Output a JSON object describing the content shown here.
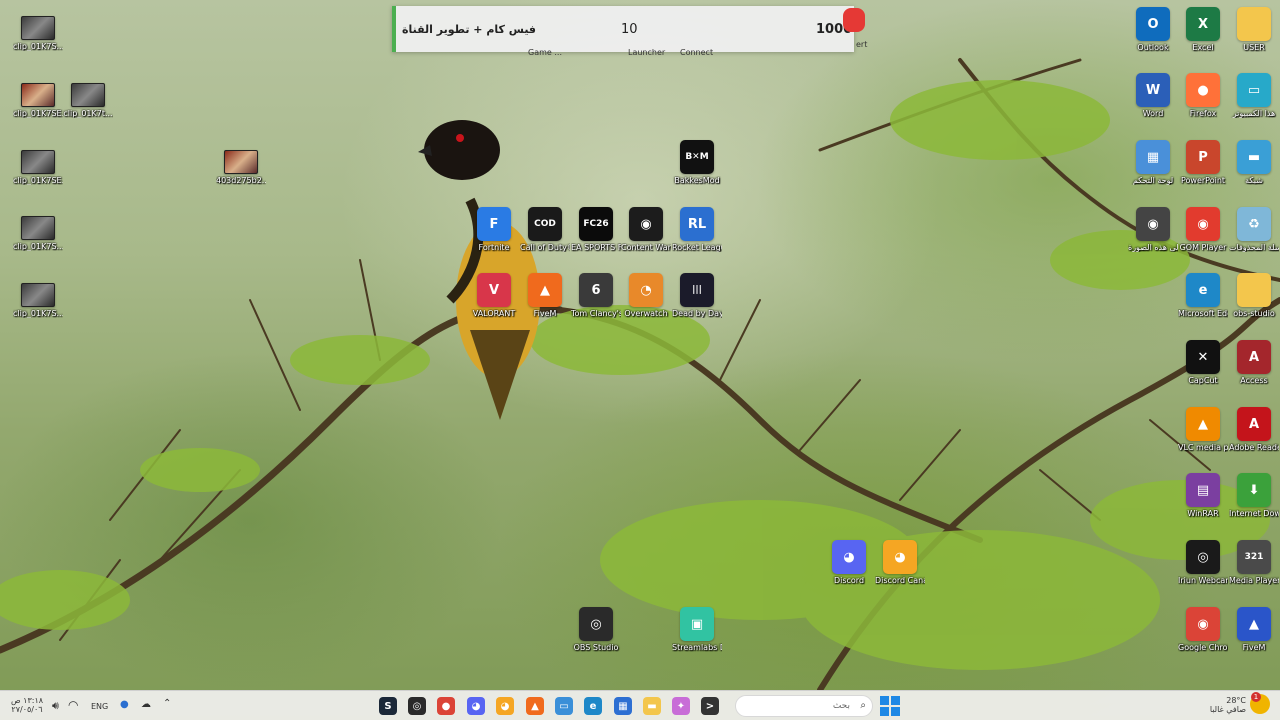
{
  "stream_overlay": {
    "title": "فيس كام + تطوير القناة",
    "current": "10",
    "goal": "1000",
    "peek_labels": [
      "Game ...",
      "Launcher",
      "Connect"
    ],
    "peek_right": "ert"
  },
  "desktop_icons_left": [
    {
      "label": "clip_01K7S..."
    },
    {
      "label": "clip_01K7SE..."
    },
    {
      "label": "clip_01K7t..."
    },
    {
      "label": "clip_01K7SE..."
    },
    {
      "label": "403d275b2..."
    },
    {
      "label": "clip_01K7S..."
    },
    {
      "label": "clip_01K7S..."
    }
  ],
  "desktop_icons_center": [
    {
      "label": "BakkesMod",
      "icon": "bakkesmod-icon",
      "glyph": "B✕M",
      "color": "#111111"
    },
    {
      "label": "Fortnite",
      "icon": "fortnite-icon",
      "glyph": "F",
      "color": "#2a7be4"
    },
    {
      "label": "Call of Duty® ...",
      "icon": "call-of-duty-icon",
      "glyph": "COD",
      "color": "#1a1a1a"
    },
    {
      "label": "EA SPORTS FC 26",
      "icon": "ea-fc-icon",
      "glyph": "FC26",
      "color": "#0b0b0b"
    },
    {
      "label": "Content Warning",
      "icon": "content-warning-icon",
      "glyph": "◉",
      "color": "#1c1c1c"
    },
    {
      "label": "Rocket League®",
      "icon": "rocket-league-icon",
      "glyph": "RL",
      "color": "#2b6fd0"
    },
    {
      "label": "VALORANT",
      "icon": "valorant-icon",
      "glyph": "V",
      "color": "#d8364a"
    },
    {
      "label": "FiveM",
      "icon": "fivem-icon",
      "glyph": "▲",
      "color": "#f06a1d"
    },
    {
      "label": "Tom Clancy's Rainbow Si...",
      "icon": "rainbow-six-icon",
      "glyph": "6",
      "color": "#3a3a3a"
    },
    {
      "label": "Overwatch",
      "icon": "overwatch-icon",
      "glyph": "◔",
      "color": "#e8892a"
    },
    {
      "label": "Dead by Daylight",
      "icon": "dead-by-daylight-icon",
      "glyph": "|||",
      "color": "#1b1b2a"
    },
    {
      "label": "Discord",
      "icon": "discord-icon",
      "glyph": "◕",
      "color": "#5865f2"
    },
    {
      "label": "Discord Canary",
      "icon": "discord-canary-icon",
      "glyph": "◕",
      "color": "#f5a623"
    },
    {
      "label": "OBS Studio",
      "icon": "obs-icon",
      "glyph": "◎",
      "color": "#2a2a2a"
    },
    {
      "label": "Streamlabs Desktop",
      "icon": "streamlabs-icon",
      "glyph": "▣",
      "color": "#31c3a2"
    }
  ],
  "desktop_icons_right": [
    {
      "label": "Outlook",
      "icon": "outlook-icon",
      "glyph": "O",
      "color": "#0f6cbd"
    },
    {
      "label": "Excel",
      "icon": "excel-icon",
      "glyph": "X",
      "color": "#1d7a45"
    },
    {
      "label": "USER",
      "icon": "folder-icon",
      "glyph": "",
      "color": "#f3c64c"
    },
    {
      "label": "Word",
      "icon": "word-icon",
      "glyph": "W",
      "color": "#2b5fb8"
    },
    {
      "label": "Firefox",
      "icon": "firefox-icon",
      "glyph": "●",
      "color": "#ff7139"
    },
    {
      "label": "هذا الكمبيوتر",
      "icon": "this-pc-icon",
      "glyph": "▭",
      "color": "#27a9c9"
    },
    {
      "label": "لوحة التحكم",
      "icon": "control-panel-icon",
      "glyph": "▦",
      "color": "#4a90d9"
    },
    {
      "label": "PowerPoint",
      "icon": "powerpoint-icon",
      "glyph": "P",
      "color": "#c9462c"
    },
    {
      "label": "شبكة",
      "icon": "network-icon",
      "glyph": "▬",
      "color": "#3a9fd6"
    },
    {
      "label": "تعرف إلى هذه الصورة",
      "icon": "camera-icon",
      "glyph": "◉",
      "color": "#444444"
    },
    {
      "label": "GOM Player",
      "icon": "gom-player-icon",
      "glyph": "◉",
      "color": "#e23b2e"
    },
    {
      "label": "سلة المحذوفات",
      "icon": "recycle-bin-icon",
      "glyph": "♻",
      "color": "#7fb7d8"
    },
    {
      "label": "Microsoft Edge",
      "icon": "edge-icon",
      "glyph": "e",
      "color": "#1e88c8"
    },
    {
      "label": "obs-studio",
      "icon": "folder-icon",
      "glyph": "",
      "color": "#f3c64c"
    },
    {
      "label": "CapCut",
      "icon": "capcut-icon",
      "glyph": "✕",
      "color": "#111111"
    },
    {
      "label": "Access",
      "icon": "access-icon",
      "glyph": "A",
      "color": "#a4262c"
    },
    {
      "label": "VLC media player",
      "icon": "vlc-icon",
      "glyph": "▲",
      "color": "#f08a00"
    },
    {
      "label": "Adobe Reader X",
      "icon": "adobe-reader-icon",
      "glyph": "A",
      "color": "#c4141b"
    },
    {
      "label": "WinRAR",
      "icon": "winrar-icon",
      "glyph": "▤",
      "color": "#7b3fa0"
    },
    {
      "label": "Internet Downlo...",
      "icon": "idm-icon",
      "glyph": "⬇",
      "color": "#3ba13b"
    },
    {
      "label": "Iriun Webcam",
      "icon": "iriun-webcam-icon",
      "glyph": "◎",
      "color": "#1a1a1a"
    },
    {
      "label": "Media Player Classic",
      "icon": "mpc-icon",
      "glyph": "321",
      "color": "#4a4a4a"
    },
    {
      "label": "Google Chrome",
      "icon": "chrome-icon",
      "glyph": "◉",
      "color": "#db4437"
    },
    {
      "label": "FiveM",
      "icon": "fivem-icon",
      "glyph": "▲",
      "color": "#2a55c9"
    }
  ],
  "taskbar": {
    "time": "١٣:١٨ ص",
    "date": "٢٧/٠٥/٠٦",
    "language": "ENG",
    "search_placeholder": "بحث",
    "weather_temp": "28°C",
    "weather_desc": "صافي غالبا",
    "notification_count": "1",
    "apps": [
      {
        "icon": "steam-icon",
        "color": "#1b2838",
        "glyph": "S"
      },
      {
        "icon": "obs-icon",
        "color": "#2a2a2a",
        "glyph": "◎"
      },
      {
        "icon": "chrome-icon",
        "color": "#db4437",
        "glyph": "●"
      },
      {
        "icon": "discord-icon",
        "color": "#5865f2",
        "glyph": "◕"
      },
      {
        "icon": "discord-canary-icon",
        "color": "#f5a623",
        "glyph": "◕"
      },
      {
        "icon": "fivem-icon",
        "color": "#f06a1d",
        "glyph": "▲"
      },
      {
        "icon": "notepad-icon",
        "color": "#3a8fd8",
        "glyph": "▭"
      },
      {
        "icon": "edge-icon",
        "color": "#1e88c8",
        "glyph": "e"
      },
      {
        "icon": "store-icon",
        "color": "#2d6fd2",
        "glyph": "▦"
      },
      {
        "icon": "file-explorer-icon",
        "color": "#f3c64c",
        "glyph": "▬"
      },
      {
        "icon": "copilot-icon",
        "color": "#c86dd7",
        "glyph": "✦"
      },
      {
        "icon": "terminal-icon",
        "color": "#333333",
        "glyph": ">"
      }
    ]
  }
}
